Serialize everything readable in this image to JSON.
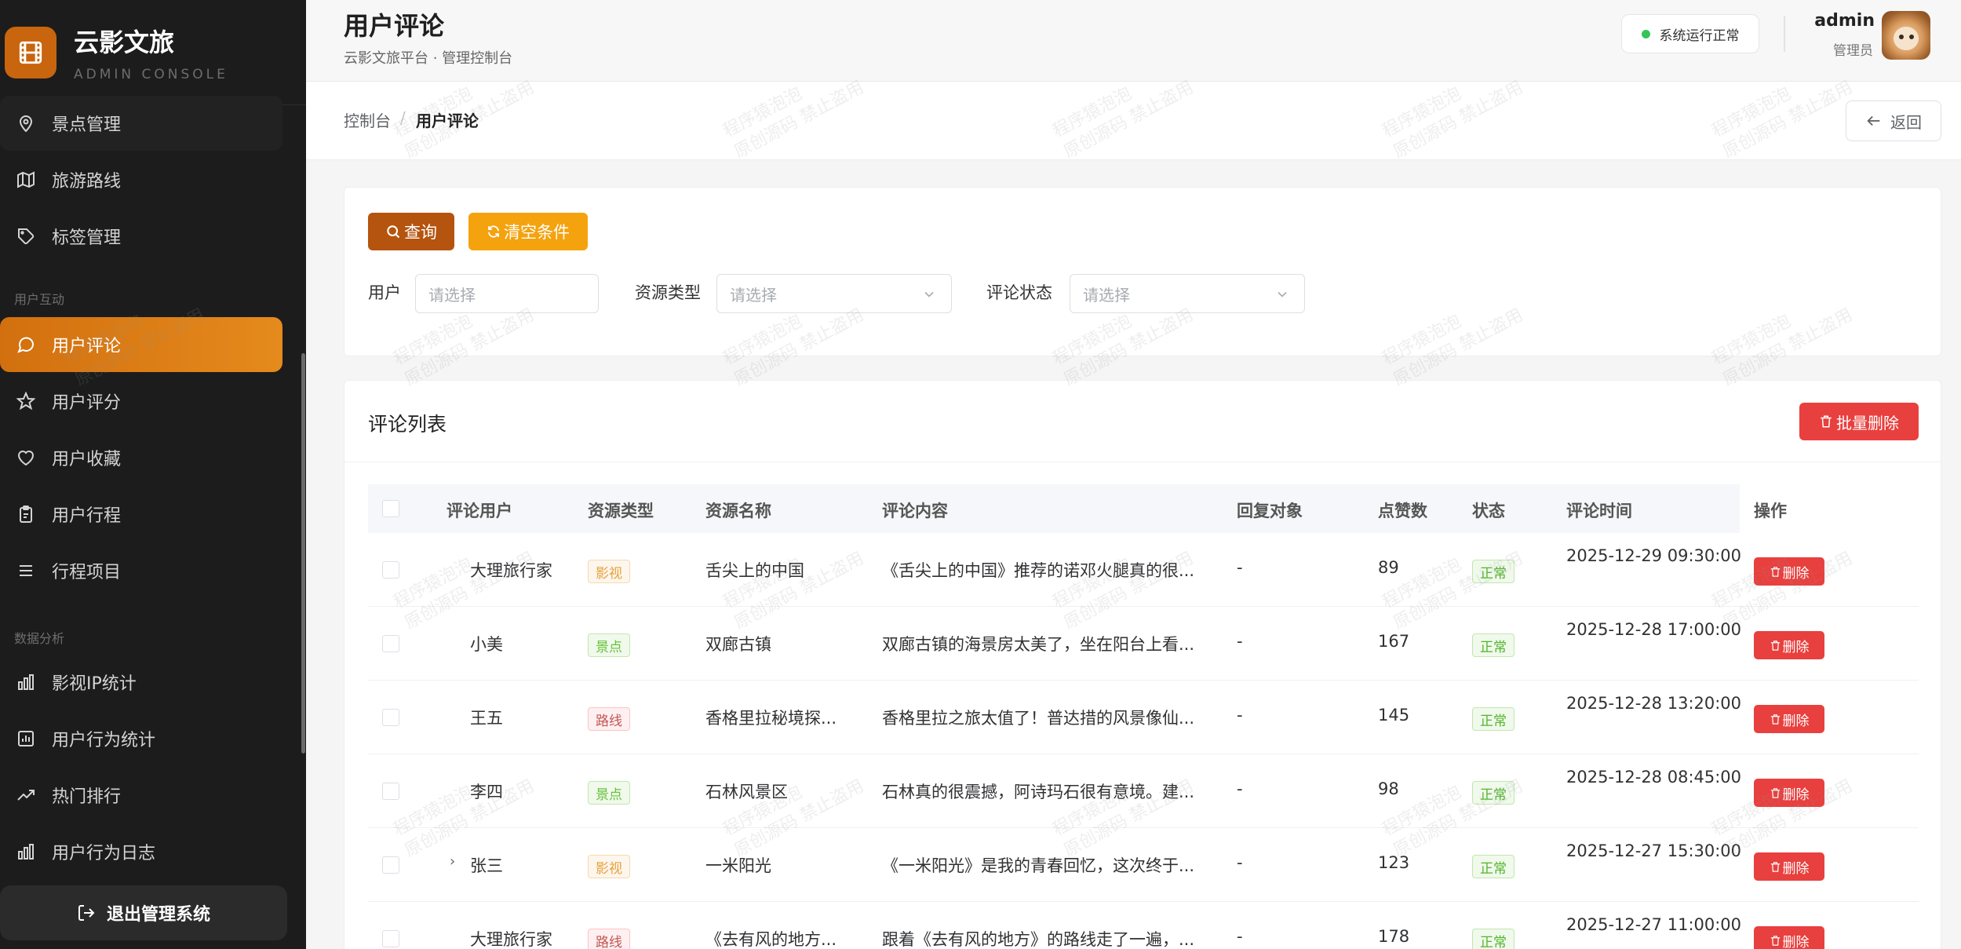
{
  "brand": {
    "title": "云影文旅",
    "subtitle": "ADMIN CONSOLE"
  },
  "sidebar": {
    "items": [
      {
        "label": "景点管理",
        "icon": "map-pin-icon"
      },
      {
        "label": "旅游路线",
        "icon": "map-icon"
      },
      {
        "label": "标签管理",
        "icon": "tag-icon"
      },
      {
        "label": "用户评论",
        "icon": "comment-icon",
        "active": true
      },
      {
        "label": "用户评分",
        "icon": "star-icon"
      },
      {
        "label": "用户收藏",
        "icon": "heart-icon"
      },
      {
        "label": "用户行程",
        "icon": "clipboard-icon"
      },
      {
        "label": "行程项目",
        "icon": "list-icon"
      },
      {
        "label": "影视IP统计",
        "icon": "bar-chart-icon"
      },
      {
        "label": "用户行为统计",
        "icon": "chart-box-icon"
      },
      {
        "label": "热门排行",
        "icon": "trend-icon"
      },
      {
        "label": "用户行为日志",
        "icon": "bar-chart-icon"
      }
    ],
    "groups": {
      "interaction": "用户互动",
      "analysis": "数据分析"
    },
    "logout_label": "退出管理系统"
  },
  "header": {
    "title": "用户评论",
    "subtitle": "云影文旅平台 · 管理控制台",
    "status": "系统运行正常",
    "user_name": "admin",
    "user_role": "管理员"
  },
  "breadcrumb": {
    "home": "控制台",
    "separator": "/",
    "current": "用户评论",
    "back_label": "返回"
  },
  "filters": {
    "query_label": "查询",
    "clear_label": "清空条件",
    "user_label": "用户",
    "user_placeholder": "请选择",
    "type_label": "资源类型",
    "type_placeholder": "请选择",
    "status_label": "评论状态",
    "status_placeholder": "请选择"
  },
  "list": {
    "title": "评论列表",
    "batch_delete_label": "批量删除",
    "columns": [
      "评论用户",
      "资源类型",
      "资源名称",
      "评论内容",
      "回复对象",
      "点赞数",
      "状态",
      "评论时间",
      "操作"
    ],
    "rows": [
      {
        "user": "大理旅行家",
        "type": "影视",
        "name": "舌尖上的中国",
        "content": "《舌尖上的中国》推荐的诺邓火腿真的很...",
        "reply": "-",
        "likes": "89",
        "status": "正常",
        "time": "2025-12-29 09:30:00",
        "action": "删除"
      },
      {
        "user": "小美",
        "type": "景点",
        "name": "双廊古镇",
        "content": "双廊古镇的海景房太美了，坐在阳台上看...",
        "reply": "-",
        "likes": "167",
        "status": "正常",
        "time": "2025-12-28 17:00:00",
        "action": "删除"
      },
      {
        "user": "王五",
        "type": "路线",
        "name": "香格里拉秘境探...",
        "content": "香格里拉之旅太值了！普达措的风景像仙...",
        "reply": "-",
        "likes": "145",
        "status": "正常",
        "time": "2025-12-28 13:20:00",
        "action": "删除"
      },
      {
        "user": "李四",
        "type": "景点",
        "name": "石林风景区",
        "content": "石林真的很震撼，阿诗玛石很有意境。建...",
        "reply": "-",
        "likes": "98",
        "status": "正常",
        "time": "2025-12-28 08:45:00",
        "action": "删除"
      },
      {
        "user": "张三",
        "type": "影视",
        "name": "一米阳光",
        "content": "《一米阳光》是我的青春回忆，这次终于...",
        "reply": "-",
        "likes": "123",
        "status": "正常",
        "time": "2025-12-27 15:30:00",
        "action": "删除",
        "expandable": true
      },
      {
        "user": "大理旅行家",
        "type": "路线",
        "name": "《去有风的地方...",
        "content": "跟着《去有风的地方》的路线走了一遍，...",
        "reply": "-",
        "likes": "178",
        "status": "正常",
        "time": "2025-12-27 11:00:00",
        "action": "删除"
      }
    ]
  },
  "watermark": {
    "line1": "程序猿泡泡",
    "line2": "原创源码 禁止盗用"
  },
  "colors": {
    "accent": "#c8650e",
    "active_gradient": "#e58a1c",
    "danger": "#e8403e",
    "warning": "#f4a20e"
  }
}
